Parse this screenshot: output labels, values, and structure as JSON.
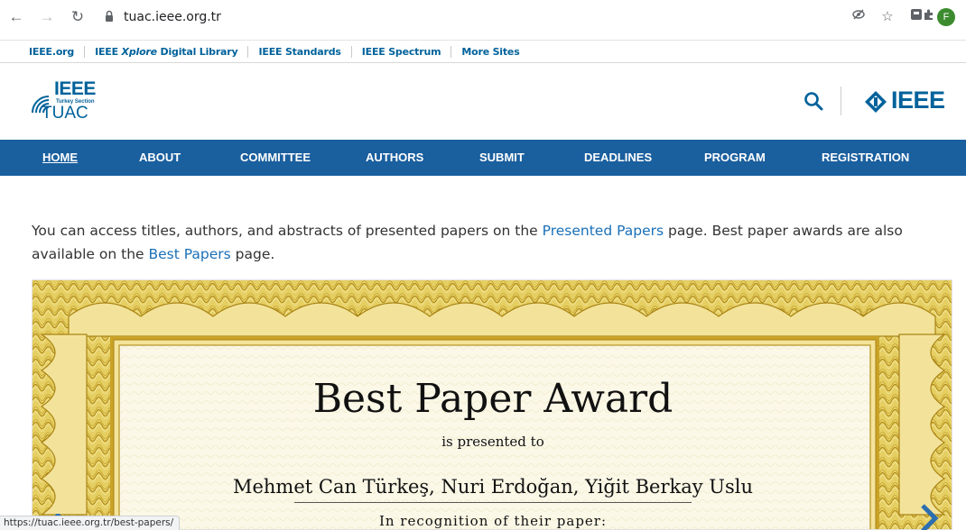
{
  "browser": {
    "url": "tuac.ieee.org.tr",
    "avatar_letter": "F",
    "status_url": "https://tuac.ieee.org.tr/best-papers/"
  },
  "metanav": {
    "items": [
      "IEEE.org",
      "IEEE Xplore Digital Library",
      "IEEE Standards",
      "IEEE Spectrum",
      "More Sites"
    ]
  },
  "header": {
    "logo_ieee": "IEEE",
    "logo_section": "Turkey Section",
    "logo_tuac": "TUAC",
    "brand_word": "IEEE"
  },
  "mainnav": {
    "items": [
      "HOME",
      "ABOUT",
      "COMMITTEE",
      "AUTHORS",
      "SUBMIT",
      "DEADLINES",
      "PROGRAM",
      "REGISTRATION"
    ],
    "active": "HOME"
  },
  "intro": {
    "part1": "You can access titles, authors, and abstracts of presented papers on the ",
    "link1": "Presented Papers",
    "part2": " page. Best paper awards are also available on the ",
    "link2": "Best Papers",
    "part3": " page."
  },
  "certificate": {
    "title": "Best Paper Award",
    "presented": "is presented to",
    "names": "Mehmet Can Türkeş, Nuri Erdoğan, Yiğit Berkay Uslu",
    "recognition": "In recognition of their paper:"
  },
  "colors": {
    "brand_blue": "#00629b",
    "nav_blue": "#1a5f9e",
    "link_blue": "#1a70b8",
    "gold": "#c9a227"
  }
}
